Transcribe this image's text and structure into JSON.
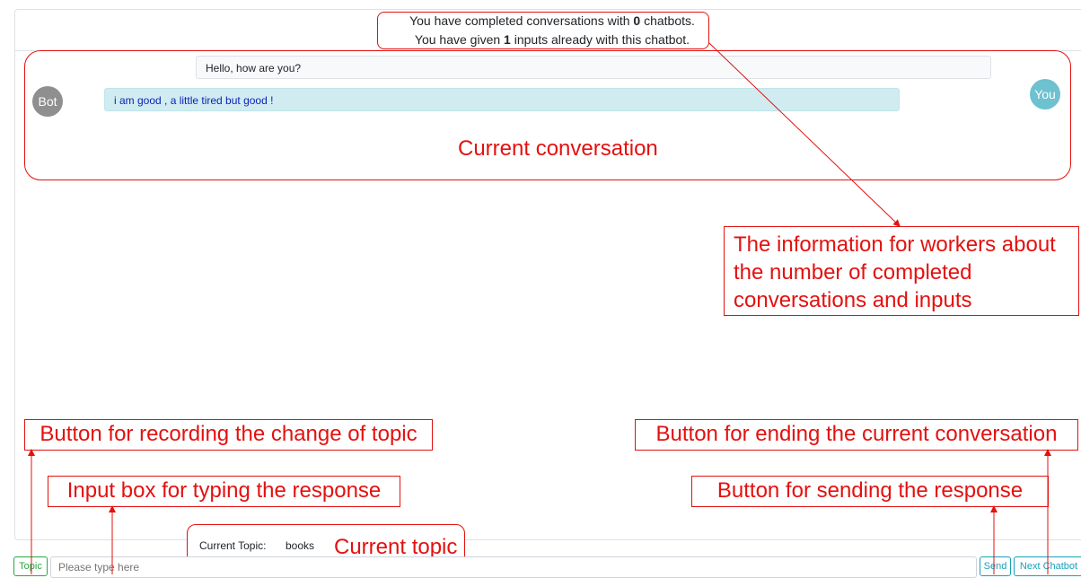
{
  "stats": {
    "line1_prefix": "You have completed conversations with ",
    "line1_count": "0",
    "line1_suffix": " chatbots.",
    "line2_prefix": "You have given ",
    "line2_count": "1",
    "line2_suffix": " inputs already with this chatbot."
  },
  "conversation": {
    "user_message": "Hello, how are you?",
    "user_avatar": "You",
    "bot_message": "i am good , a little tired but good !",
    "bot_avatar": "Bot"
  },
  "footer": {
    "topic_button": "Topic",
    "input_placeholder": "Please type here",
    "send_button": "Send",
    "next_button": "Next Chatbot",
    "current_topic_label": "Current Topic:",
    "current_topic_value": "books"
  },
  "annotations": {
    "current_conversation": "Current conversation",
    "info_for_workers": "The information for workers about the number of completed conversations and inputs",
    "topic_button_desc": "Button for recording the change of topic",
    "input_box_desc": "Input box for typing the response",
    "end_button_desc": "Button for ending the current conversation",
    "send_button_desc": "Button for sending the response",
    "current_topic": "Current topic"
  },
  "colors": {
    "annotation": "#e3110f",
    "topic_button": "#28a745",
    "send_button": "#17a2b8",
    "bot_bubble": "#d1ecf1",
    "bot_text": "#0c1fb8"
  }
}
